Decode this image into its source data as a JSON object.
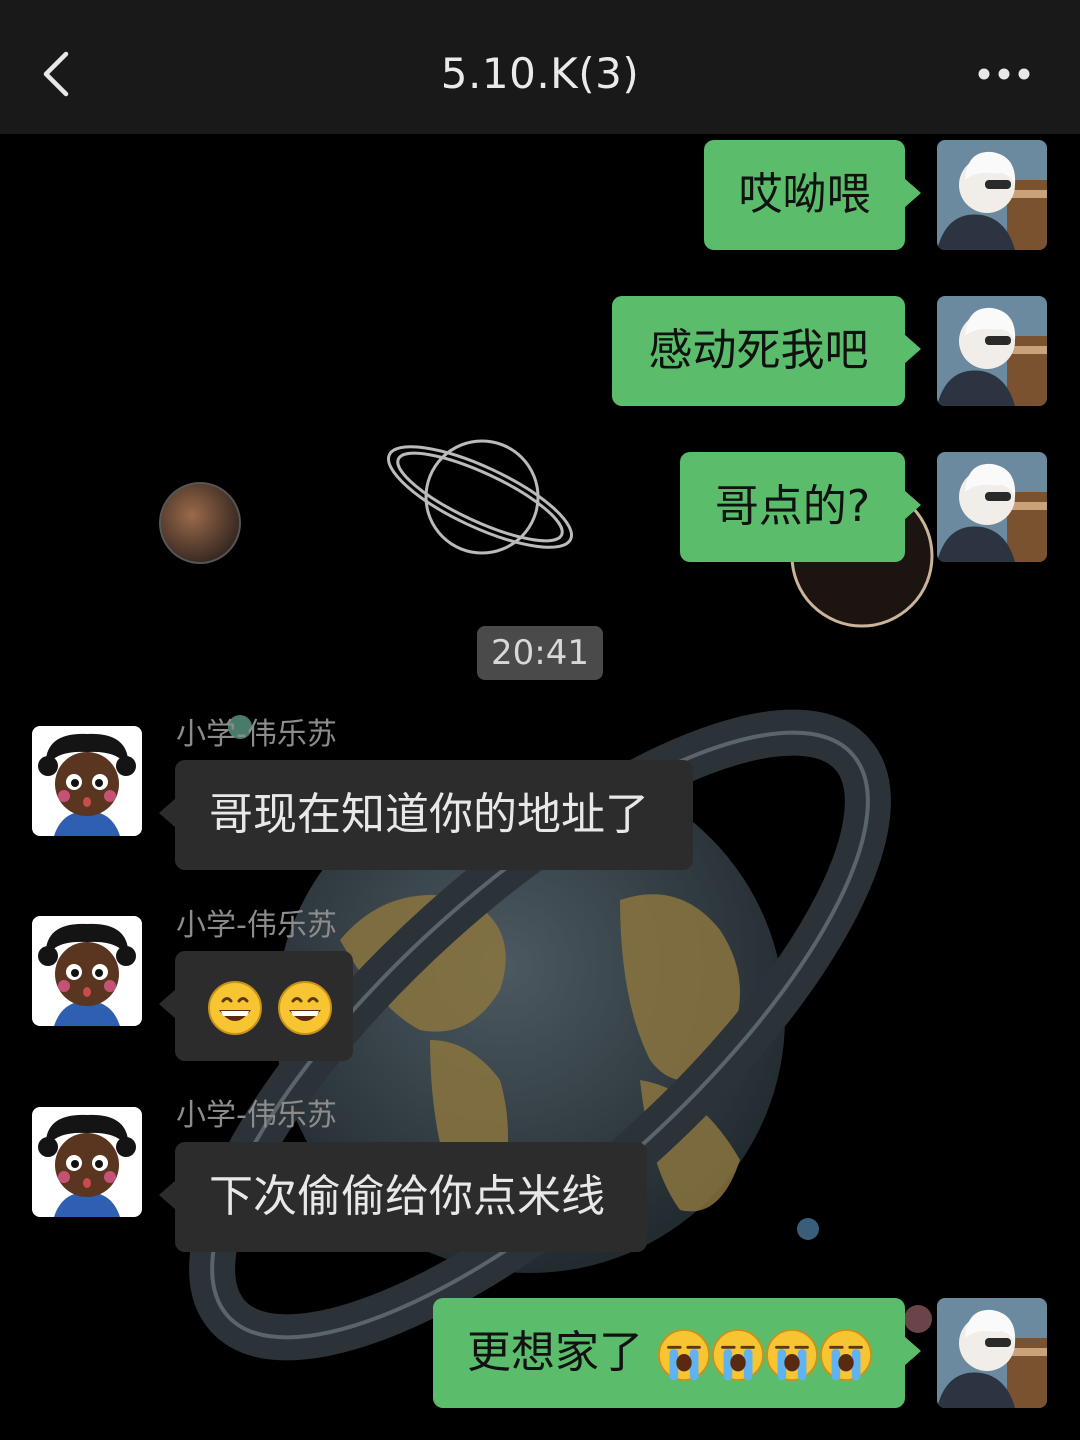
{
  "header": {
    "title": "5.10.K(3)",
    "back_icon": "chevron-left-icon",
    "more_icon": "more-dots-icon"
  },
  "timestamp": "20:41",
  "messages": [
    {
      "side": "me",
      "text": "哎呦喂"
    },
    {
      "side": "me",
      "text": "感动死我吧"
    },
    {
      "side": "me",
      "text": "哥点的?"
    },
    {
      "side": "them",
      "sender": "小学-伟乐苏",
      "text": "哥现在知道你的地址了"
    },
    {
      "side": "them",
      "sender": "小学-伟乐苏",
      "emoji": "grinning-face-emoji",
      "emoji_count": 2
    },
    {
      "side": "them",
      "sender": "小学-伟乐苏",
      "text": "下次偷偷给你点米线"
    },
    {
      "side": "me",
      "text": "更想家了",
      "emoji": "loudly-crying-face-emoji",
      "emoji_count": 4
    }
  ],
  "colors": {
    "header_bg": "#191919",
    "my_bubble": "#5bbd6c",
    "their_bubble": "#2c2c2c",
    "chat_bg": "#000000"
  }
}
